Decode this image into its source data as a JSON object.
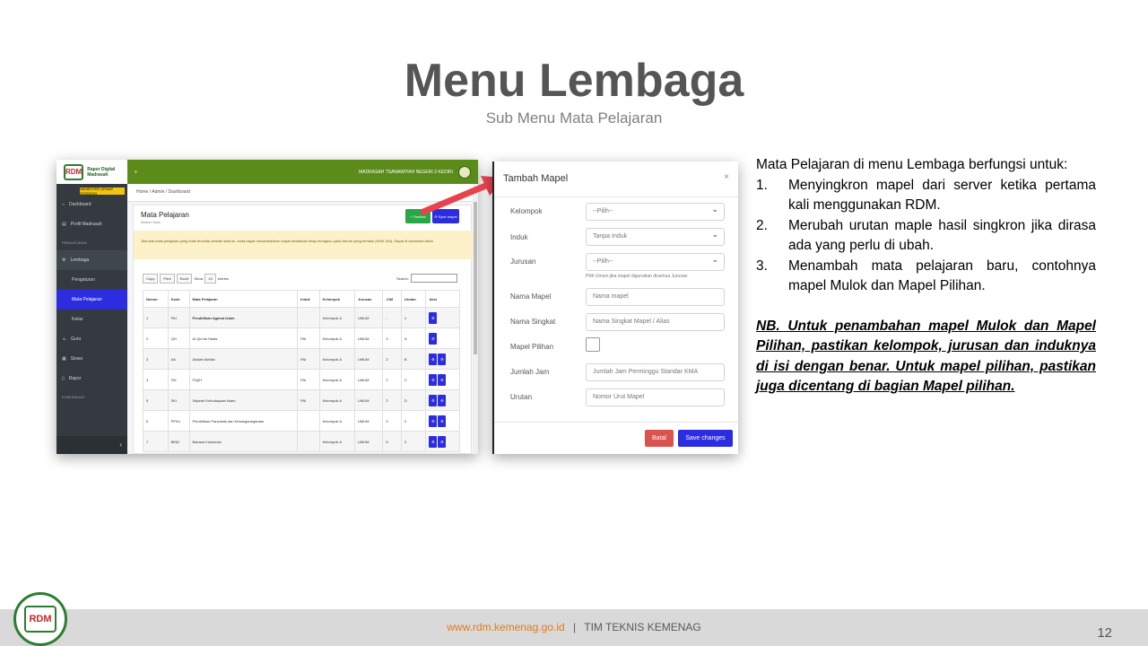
{
  "slide": {
    "title": "Menu Lembaga",
    "subtitle": "Sub Menu Mata Pelajaran",
    "page_number": "12"
  },
  "footer": {
    "link": "www.rdm.kemenag.go.id",
    "separator": "|",
    "team": "TIM TEKNIS KEMENAG"
  },
  "screenshot_left": {
    "logo_text": "Rapor Digital Madrasah",
    "logo_abbr": "RDM",
    "semester": "SEMESTER GENAP 2023/2024",
    "topbar_menu": "≡",
    "school": "MADRASAH TSANAWIYAH NEGERI 3 KEDIRI",
    "breadcrumb": "Home / Admin / Dashboard",
    "sidebar": {
      "dashboard": "Dashboard",
      "profil": "Profil Madrasah",
      "head_pengaturan": "PENGATURAN",
      "lembaga": "Lembaga",
      "pengaturan": "Pengaturan",
      "mapel": "Mata Pelajaran",
      "kelas": "Kelas",
      "guru": "Guru",
      "siswa": "Siswa",
      "rapor": "Rapor",
      "head_komunikasi": "KOMUNIKASI",
      "collapse": "‹"
    },
    "card_title": "Mata Pelajaran",
    "card_sub": "Master Data",
    "btn_tambah": "+ Tambah",
    "btn_sync": "⟳ Sync mapel",
    "alert": "Jika ada mata pelajaran yang tidak tersedia setelah sinkron, anda dapat menambahkan mapel tambahan tetap mengacu pada Aturan yang berlaku (KMA 184). Dapat di download disini",
    "tools": {
      "copy": "Copy",
      "print": "Print",
      "excel": "Excel",
      "show": "Show",
      "entries_value": "10",
      "entries": "entries"
    },
    "search_label": "Search:",
    "columns": [
      "Nomor",
      "Kode",
      "Mata Pelajaran",
      "Induk",
      "Kelompok",
      "Jurusan",
      "JJM",
      "Urutan",
      "Aksi"
    ],
    "rows": [
      [
        "1",
        "PAI",
        "Pendidikan Agama Islam",
        "",
        "Kelompok A",
        "UMUM",
        "-",
        "1"
      ],
      [
        "2",
        "QH",
        "Al Qur'an Hadis",
        "PAI",
        "Kelompok A",
        "UMUM",
        "2",
        "A"
      ],
      [
        "3",
        "AA",
        "Akidah Akhlak",
        "PAI",
        "Kelompok A",
        "UMUM",
        "2",
        "B"
      ],
      [
        "4",
        "FIK",
        "FIQIH",
        "PAI",
        "Kelompok A",
        "UMUM",
        "2",
        "C"
      ],
      [
        "5",
        "SKI",
        "Sejarah Kebudayaan Islam",
        "PAI",
        "Kelompok A",
        "UMUM",
        "2",
        "D"
      ],
      [
        "6",
        "PPKn",
        "Pendidikan Pancasila dan Kewarganegaraan",
        "",
        "Kelompok A",
        "UMUM",
        "3",
        "2"
      ],
      [
        "7",
        "BIND",
        "Bahasa Indonesia",
        "",
        "Kelompok A",
        "UMUM",
        "6",
        "3"
      ]
    ],
    "action_icon": "⚙"
  },
  "modal": {
    "title": "Tambah Mapel",
    "close": "×",
    "fields": {
      "kelompok_label": "Kelompok",
      "kelompok_value": "--Pilih--",
      "induk_label": "Induk",
      "induk_value": "Tanpa Induk",
      "jurusan_label": "Jurusan",
      "jurusan_value": "--Pilih--",
      "jurusan_hint": "Pilih Umum jika mapel digunakan disemua Jurusan",
      "nama_label": "Nama Mapel",
      "nama_placeholder": "Nama mapel",
      "singkat_label": "Nama Singkat",
      "singkat_placeholder": "Nama Singkat Mapel / Alias",
      "pilihan_label": "Mapel Pilihan",
      "jam_label": "Jumlah Jam",
      "jam_placeholder": "Jumlah Jam Perminggu Standar KMA",
      "urutan_label": "Urutan",
      "urutan_placeholder": "Nomor Urut Mapel"
    },
    "btn_batal": "Batal",
    "btn_save": "Save changes"
  },
  "description": {
    "intro": "Mata Pelajaran di menu Lembaga berfungsi untuk:",
    "items": [
      {
        "num": "1.",
        "text": "Menyingkron mapel dari server ketika pertama kali menggunakan RDM."
      },
      {
        "num": "2.",
        "text": "Merubah urutan maple hasil singkron jika dirasa ada yang perlu di ubah."
      },
      {
        "num": "3.",
        "text": "Menambah mata pelajaran baru, contohnya mapel Mulok dan Mapel Pilihan."
      }
    ],
    "nb": "NB. Untuk penambahan mapel Mulok dan Mapel Pilihan, pastikan kelompok, jurusan dan induknya di isi dengan benar. Untuk mapel pilihan, pastikan juga dicentang di bagian Mapel pilihan."
  },
  "logo_abbr": "RDM",
  "colors": {
    "accent_blue": "#2c2ce0",
    "topbar_green": "#5b8c1a",
    "arrow_red": "#e8424f",
    "footer_link": "#e07b1a"
  }
}
